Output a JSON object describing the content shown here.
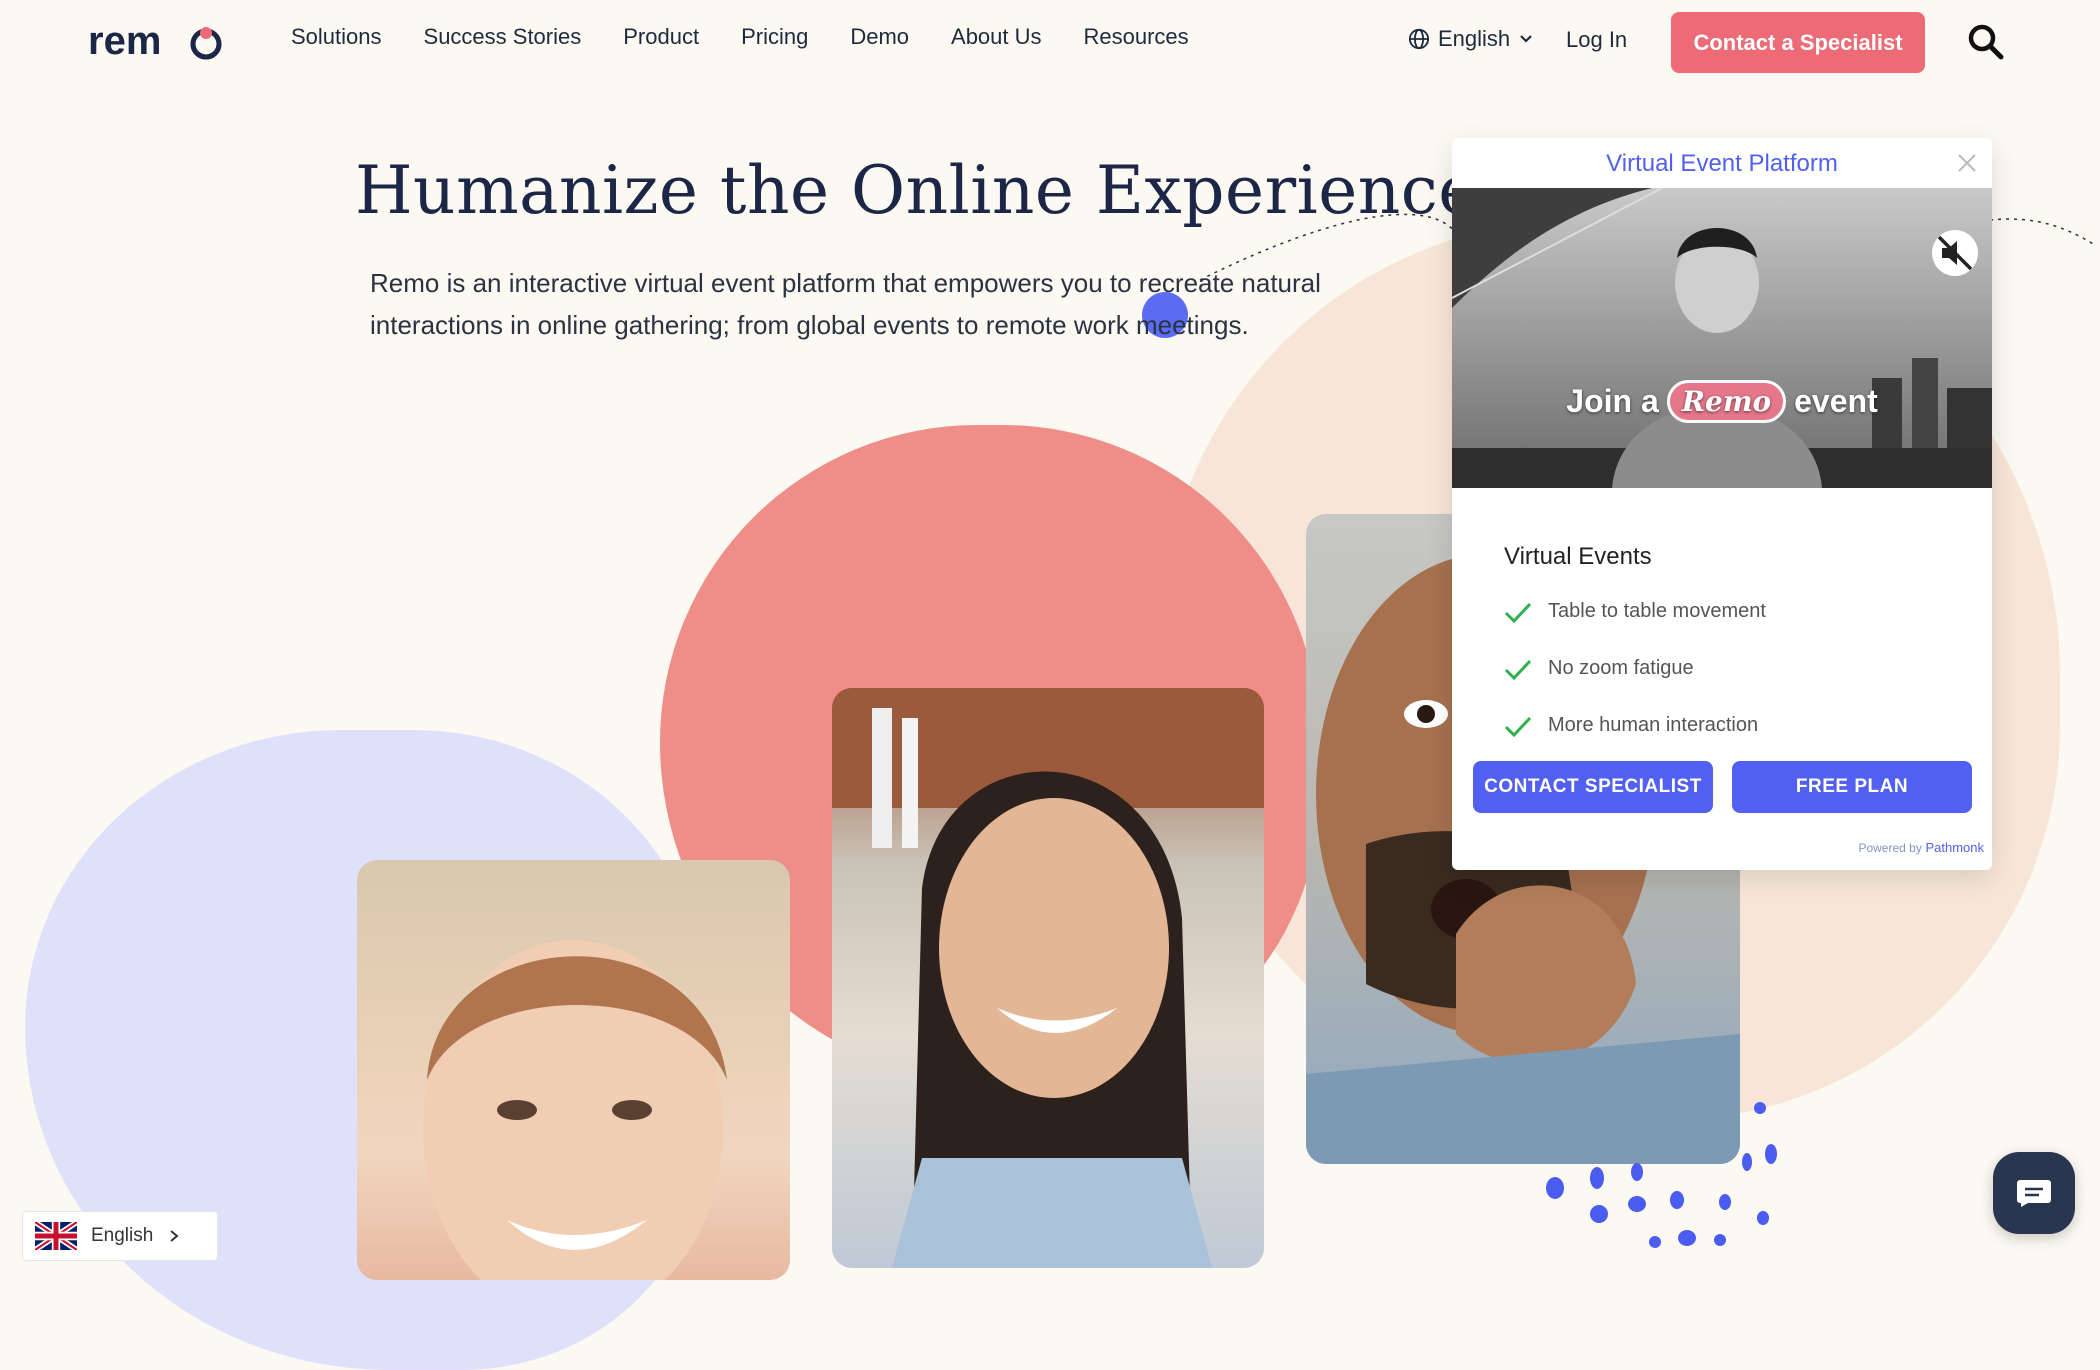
{
  "brand": {
    "name": "remo",
    "accent_color": "#ec6b77",
    "primary_color": "#5160f0"
  },
  "nav": {
    "items": [
      "Solutions",
      "Success Stories",
      "Product",
      "Pricing",
      "Demo",
      "About Us",
      "Resources"
    ],
    "language": "English",
    "login": "Log In",
    "cta": "Contact a Specialist"
  },
  "hero": {
    "title": "Humanize the Online Experience",
    "subtitle": "Remo is an interactive virtual event platform that empowers you to recreate natural interactions in online gathering; from global events to remote work meetings."
  },
  "popup": {
    "title": "Virtual Event Platform",
    "video_caption_prefix": "Join a",
    "video_caption_brand": "Remo",
    "video_caption_suffix": "event",
    "features_title": "Virtual Events",
    "features": [
      "Table to table movement",
      "No zoom fatigue",
      "More human interaction"
    ],
    "contact_button": "CONTACT SPECIALIST",
    "free_button": "FREE PLAN",
    "powered_by": "Powered by",
    "powered_brand": "Pathmonk"
  },
  "language_switcher": {
    "label": "English"
  }
}
